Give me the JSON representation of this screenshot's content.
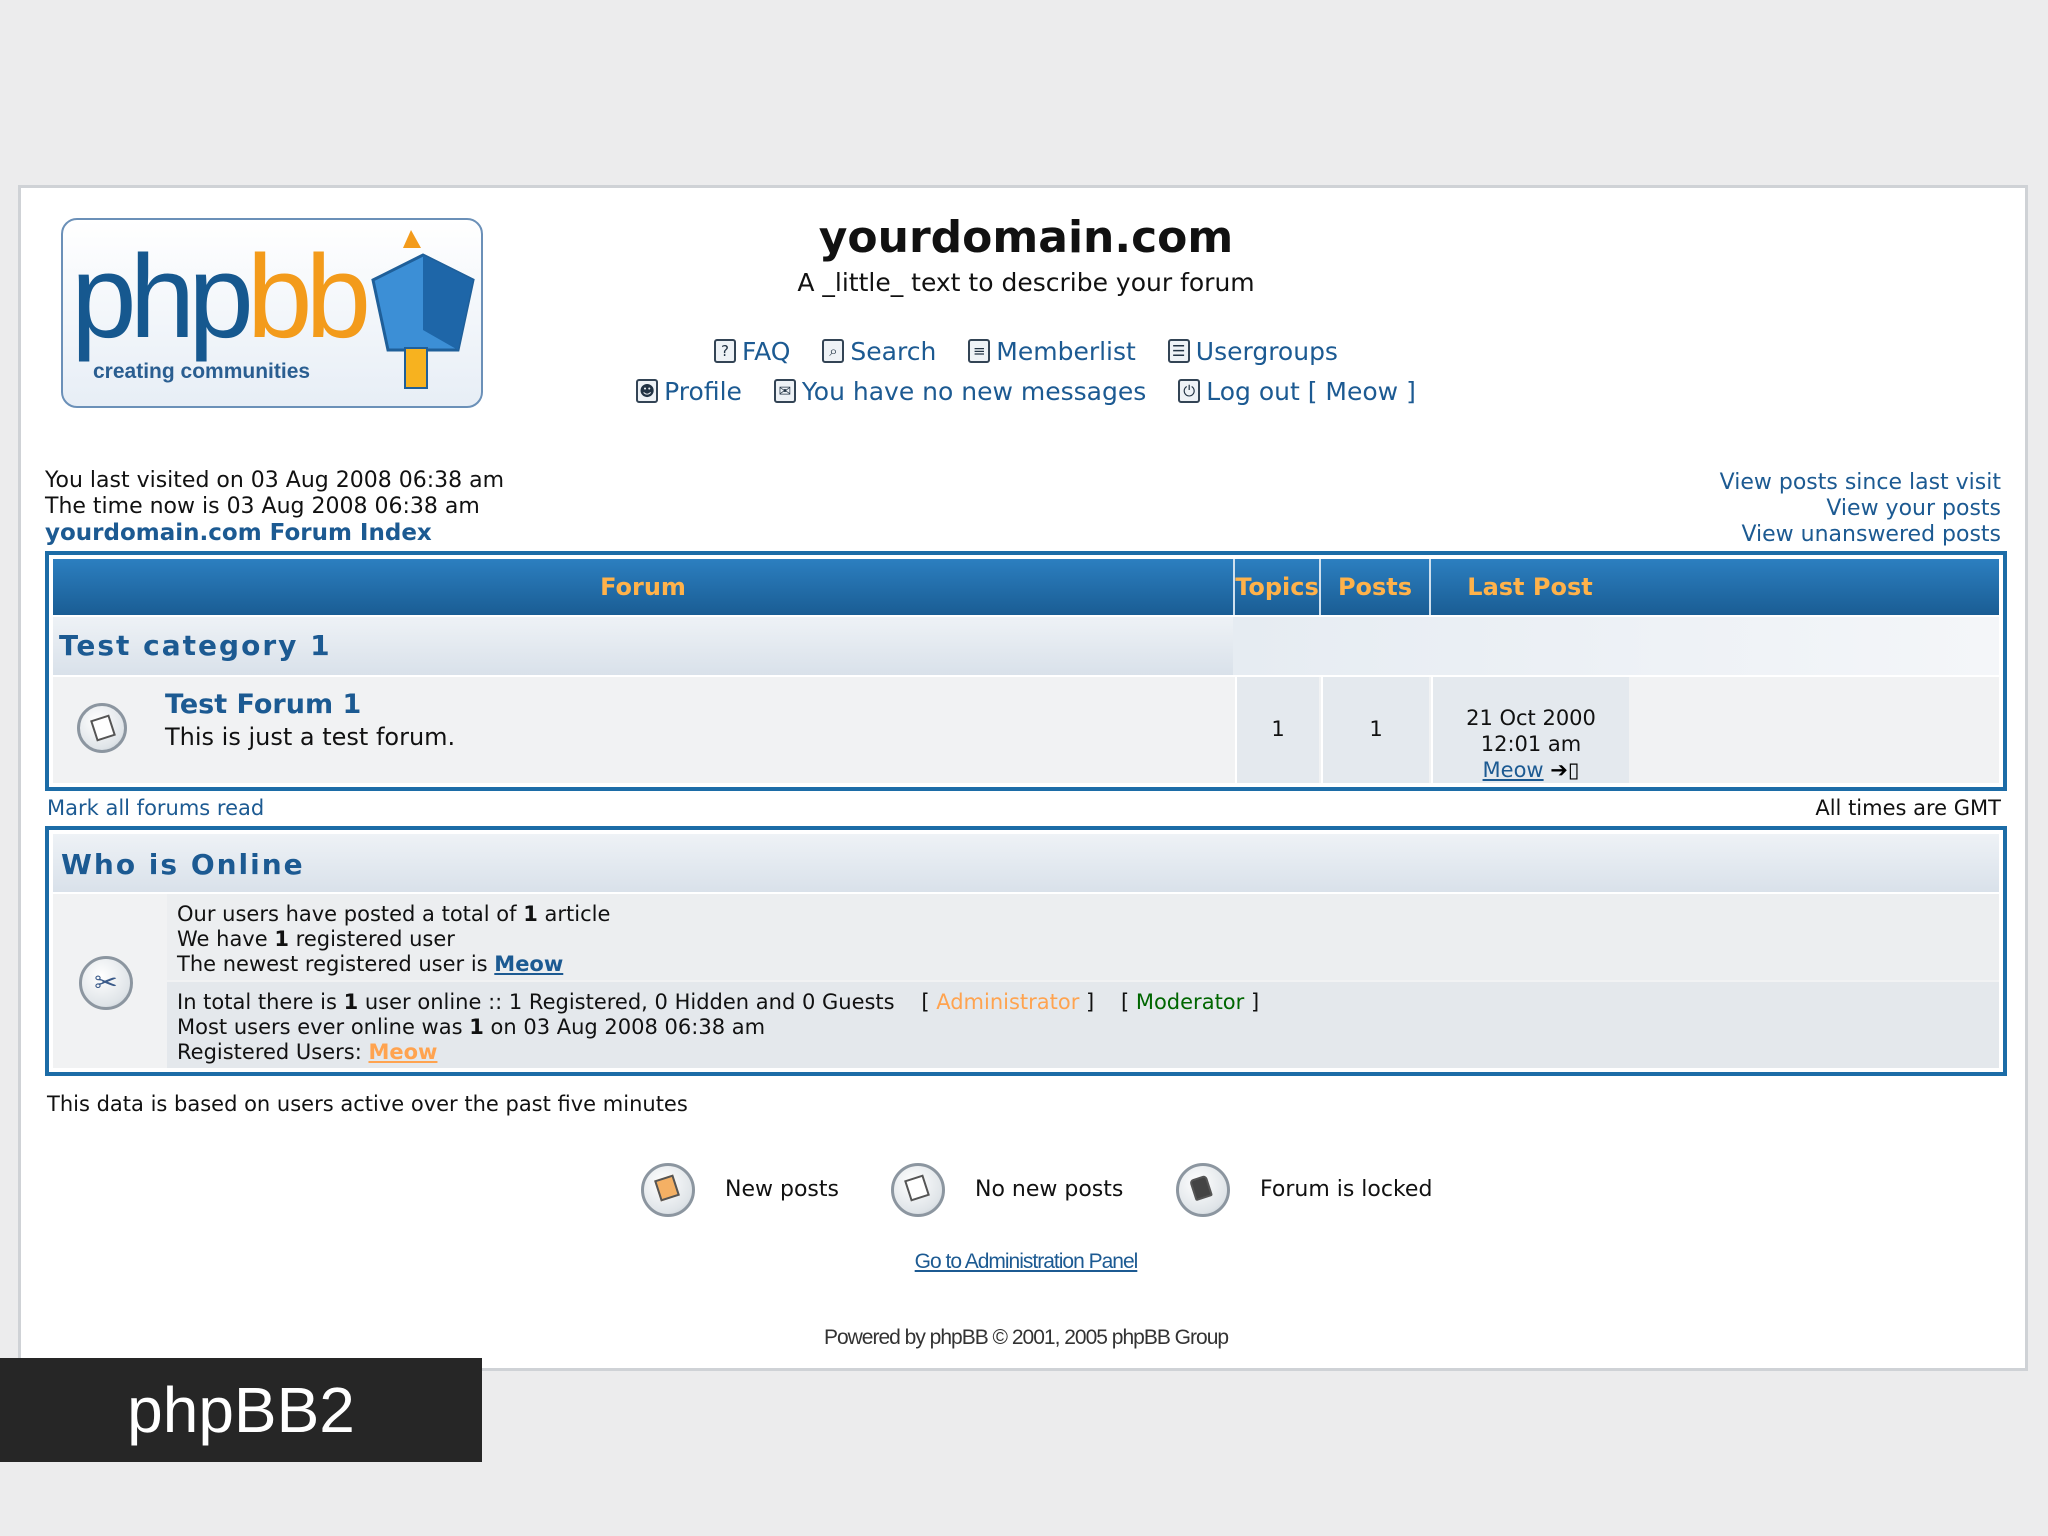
{
  "site": {
    "title": "yourdomain.com",
    "description": "A _little_ text to describe your forum",
    "logo_main": "php",
    "logo_accent": "bb",
    "logo_tagline": "creating communities"
  },
  "nav": {
    "faq": "FAQ",
    "search": "Search",
    "memberlist": "Memberlist",
    "usergroups": "Usergroups",
    "profile": "Profile",
    "messages": "You have no new messages",
    "logout": "Log out [ Meow ]"
  },
  "info": {
    "last_visit": "You last visited on 03 Aug 2008 06:38 am",
    "time_now": "The time now is 03 Aug 2008 06:38 am",
    "forum_index": "yourdomain.com Forum Index",
    "posts_since": "View posts since last visit",
    "your_posts": "View your posts",
    "unanswered": "View unanswered posts"
  },
  "table": {
    "headers": {
      "forum": "Forum",
      "topics": "Topics",
      "posts": "Posts",
      "last_post": "Last Post"
    },
    "category": "Test category 1",
    "forum": {
      "name": "Test Forum 1",
      "description": "This is just a test forum.",
      "topics": "1",
      "posts": "1",
      "last_post_date": "21 Oct 2000 12:01 am",
      "last_post_user": "Meow",
      "last_post_arrow": "➔▯"
    }
  },
  "mid": {
    "mark_read": "Mark all forums read",
    "timezone": "All times are GMT"
  },
  "who": {
    "title": "Who is Online",
    "posted_pre": "Our users have posted a total of ",
    "posted_num": "1",
    "posted_post": " article",
    "registered_pre": "We have ",
    "registered_num": "1",
    "registered_post": " registered user",
    "newest_pre": "The newest registered user is ",
    "newest_user": "Meow",
    "online_pre": "In total there is ",
    "online_num": "1",
    "online_post": " user online :: 1 Registered, 0 Hidden and 0 Guests",
    "admin_open": "[",
    "admin_label": "Administrator",
    "admin_close": "]",
    "mod_open": "[",
    "mod_label": "Moderator",
    "mod_close": "]",
    "most_pre": "Most users ever online was ",
    "most_num": "1",
    "most_post": " on 03 Aug 2008 06:38 am",
    "reg_users_label": "Registered Users: ",
    "reg_users": "Meow"
  },
  "footnote": "This data is based on users active over the past five minutes",
  "legend": {
    "new": "New posts",
    "no_new": "No new posts",
    "locked": "Forum is locked"
  },
  "admin_link": "Go to Administration Panel",
  "powered": "Powered by phpBB © 2001, 2005 phpBB Group",
  "caption": "phpBB2",
  "icons": [
    "help-icon",
    "search-icon",
    "memberlist-icon",
    "usergroups-icon",
    "profile-icon",
    "messages-icon",
    "logout-icon",
    "forum-folder-icon",
    "who-online-icon",
    "new-posts-icon",
    "no-new-posts-icon",
    "locked-icon"
  ],
  "colors": {
    "accent": "#1c6ca7",
    "header_text": "#ffb24a",
    "link": "#1c5a92",
    "admin": "#ffa34f",
    "moderator": "#006600"
  }
}
